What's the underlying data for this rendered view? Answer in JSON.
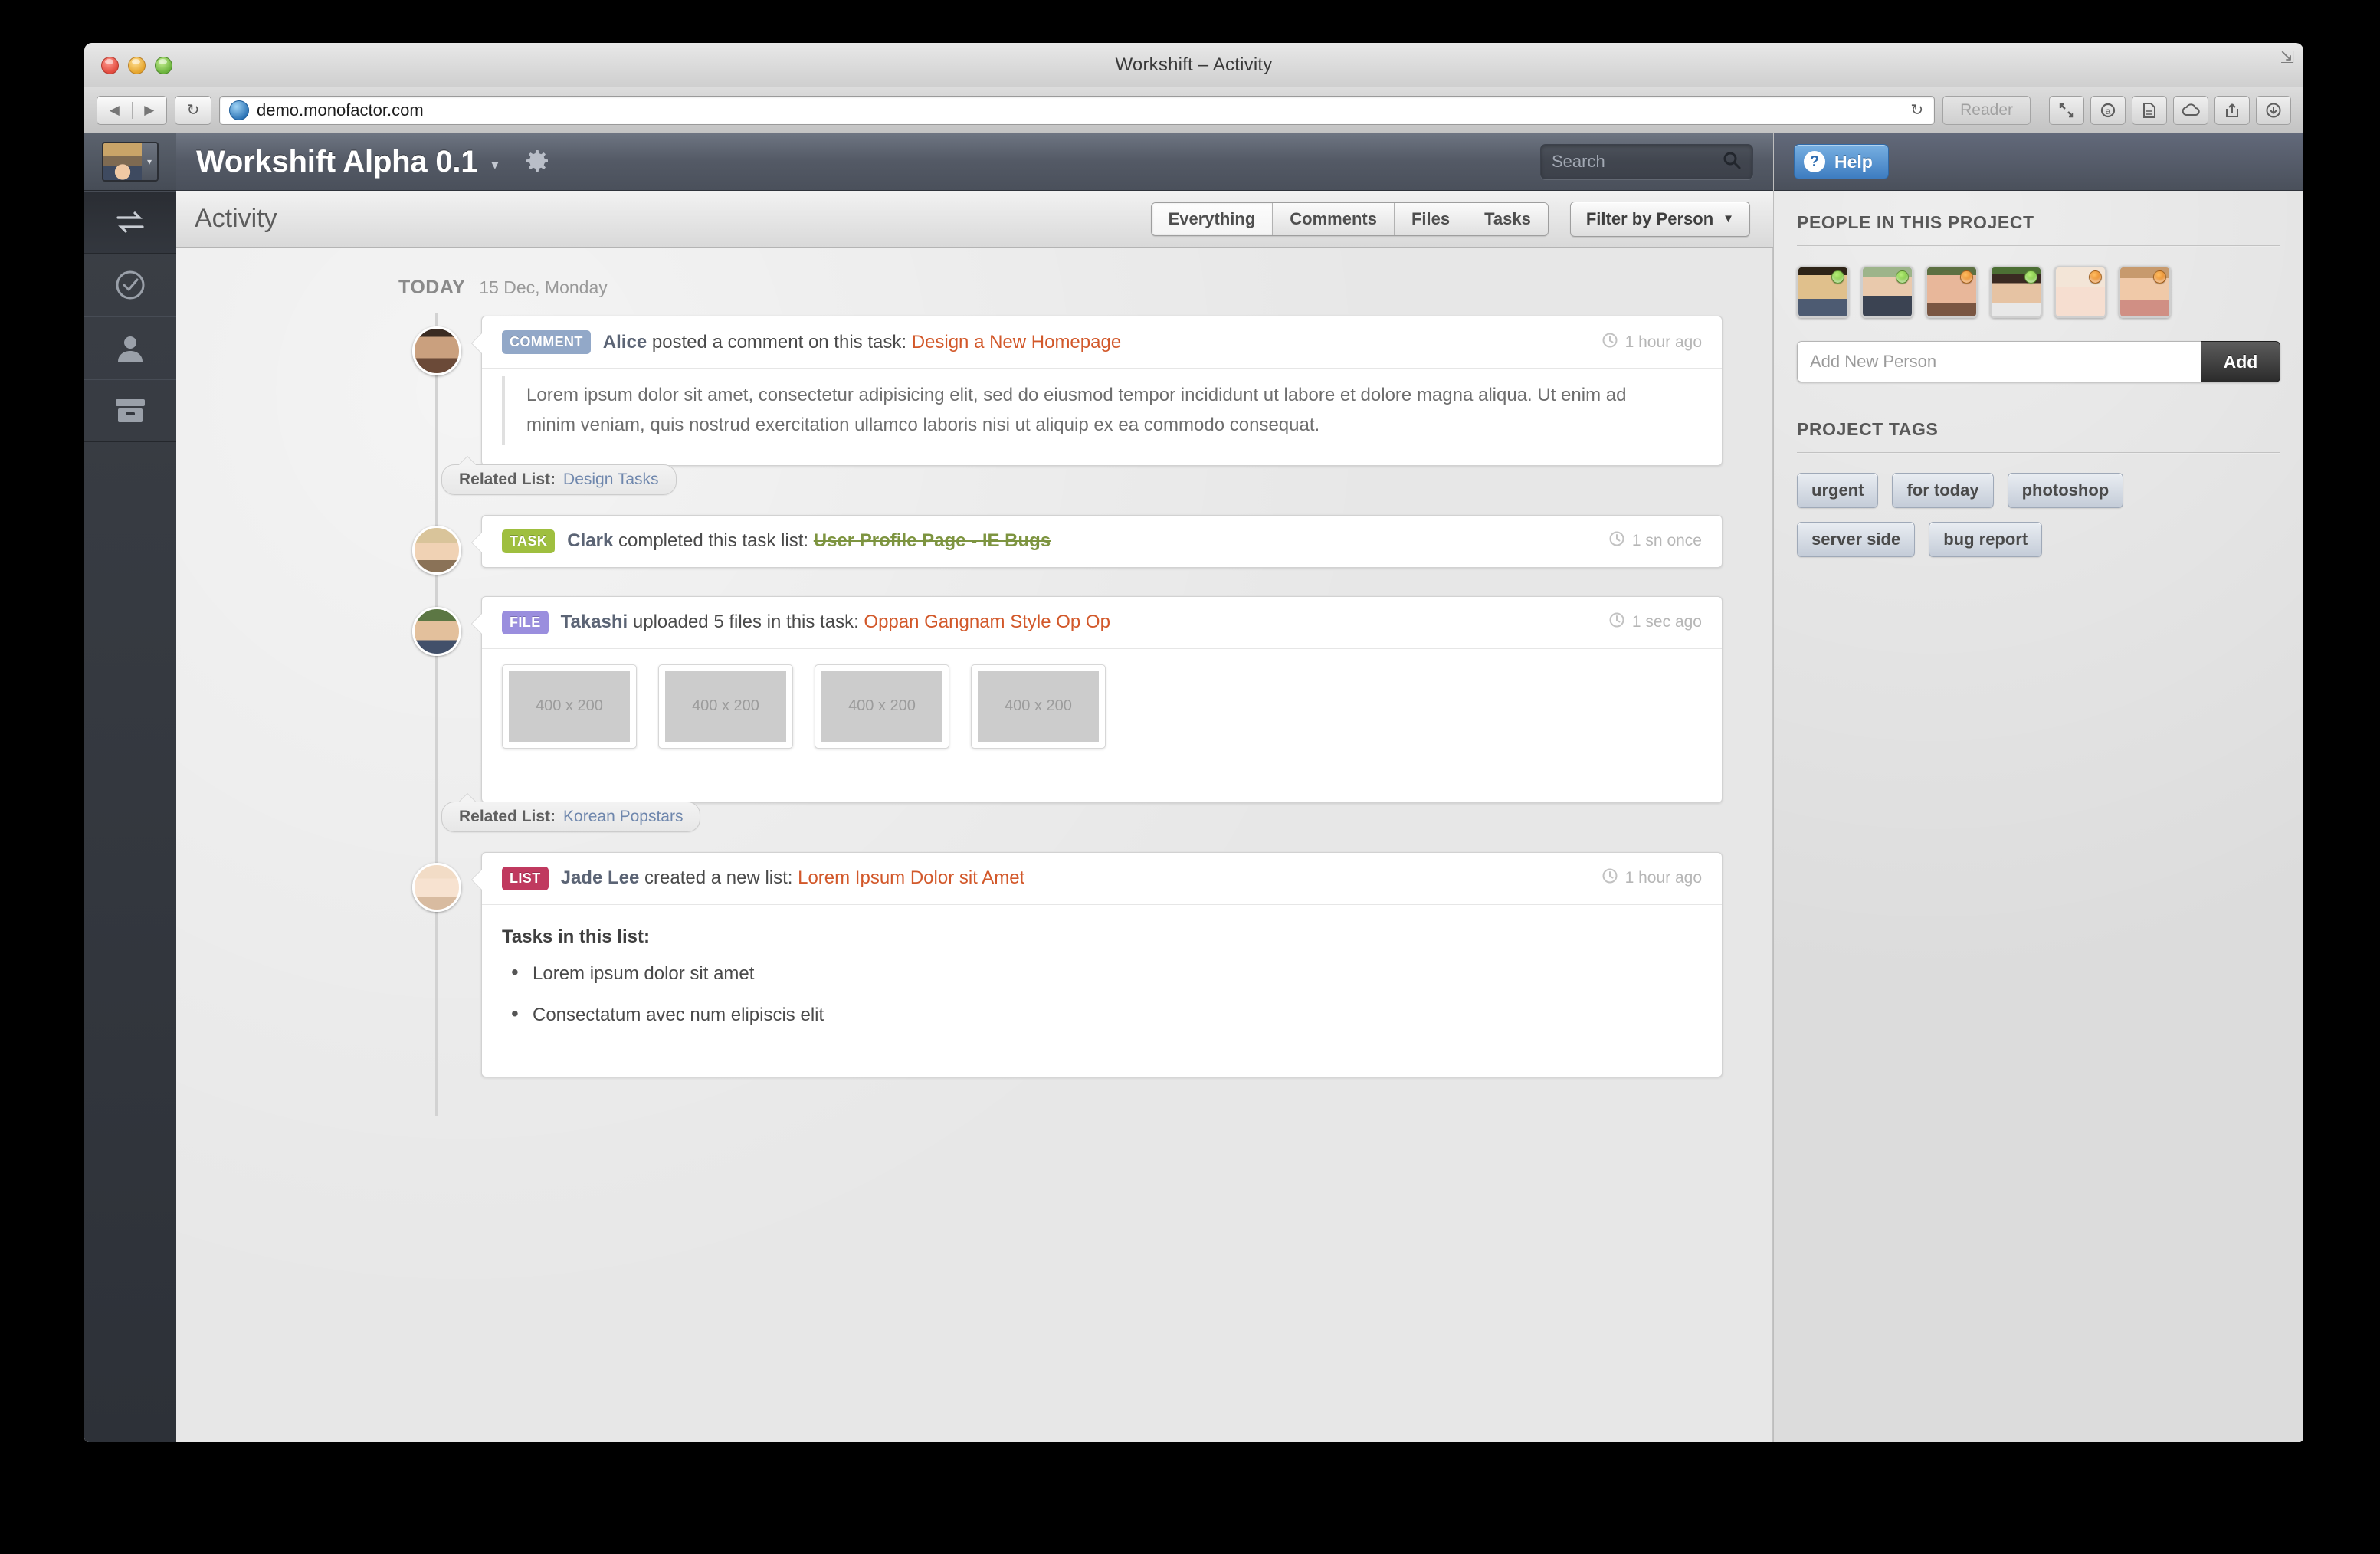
{
  "browser": {
    "window_title": "Workshift – Activity",
    "url": "demo.monofactor.com",
    "reader_label": "Reader",
    "back_icon": "back-arrow-icon",
    "forward_icon": "forward-arrow-icon",
    "reload_icon": "reload-icon",
    "globe_icon": "globe-icon",
    "toolbar_icons": [
      "fullscreen-icon",
      "private-browsing-icon",
      "reading-list-icon",
      "icloud-tabs-icon",
      "share-icon",
      "downloads-icon"
    ]
  },
  "rail": {
    "avatar": "user-avatar",
    "items": [
      {
        "name": "activity",
        "icon": "activity-arrows-icon"
      },
      {
        "name": "tasks",
        "icon": "check-circle-icon"
      },
      {
        "name": "people",
        "icon": "person-icon"
      },
      {
        "name": "archive",
        "icon": "archive-box-icon"
      }
    ]
  },
  "header": {
    "app_title": "Workshift Alpha 0.1",
    "title_caret": "▾",
    "gear_icon": "gear-icon",
    "search_placeholder": "Search",
    "search_icon": "search-icon",
    "help_label": "Help",
    "help_icon": "question-mark-icon"
  },
  "sub_header": {
    "page_title": "Activity",
    "tabs": [
      {
        "label": "Everything",
        "active": true
      },
      {
        "label": "Comments",
        "active": false
      },
      {
        "label": "Files",
        "active": false
      },
      {
        "label": "Tasks",
        "active": false
      }
    ],
    "filter_label": "Filter by Person",
    "filter_caret": "▼"
  },
  "feed": {
    "today_label": "TODAY",
    "today_date": "15 Dec, Monday",
    "entries": [
      {
        "badge": "COMMENT",
        "badge_type": "comment",
        "who": "Alice",
        "action": " posted a comment on this task: ",
        "target": "Design a New Homepage",
        "timestamp": "1 hour ago",
        "quote": "Lorem ipsum dolor sit amet, consectetur adipisicing elit, sed do eiusmod tempor incididunt ut labore et dolore magna aliqua. Ut enim ad minim veniam, quis nostrud exercitation ullamco laboris nisi ut aliquip ex ea commodo consequat.",
        "related_label": "Related List:",
        "related_link": "Design Tasks"
      },
      {
        "badge": "TASK",
        "badge_type": "task",
        "who": "Clark",
        "action": " completed this task list: ",
        "target": "User Profile Page - IE Bugs",
        "timestamp": "1 sn once"
      },
      {
        "badge": "FILE",
        "badge_type": "file",
        "who": "Takashi",
        "action": " uploaded 5 files in this task: ",
        "target": "Oppan Gangnam Style Op Op",
        "timestamp": "1 sec ago",
        "thumbs": [
          "400 x 200",
          "400 x 200",
          "400 x 200",
          "400 x 200"
        ],
        "related_label": "Related List:",
        "related_link": "Korean Popstars"
      },
      {
        "badge": "LIST",
        "badge_type": "list",
        "who": "Jade Lee",
        "action": " created a new list: ",
        "target": "Lorem Ipsum Dolor sit Amet",
        "timestamp": "1 hour ago",
        "tasks_title": "Tasks in this list:",
        "tasks": [
          "Lorem ipsum dolor sit amet",
          "Consectatum avec num elipiscis elit"
        ]
      }
    ]
  },
  "right_panel": {
    "people_heading": "PEOPLE IN THIS PROJECT",
    "people": [
      {
        "name": "person-1",
        "status": "online"
      },
      {
        "name": "person-2",
        "status": "online"
      },
      {
        "name": "person-3",
        "status": "away"
      },
      {
        "name": "person-4",
        "status": "online"
      },
      {
        "name": "person-5",
        "status": "away"
      },
      {
        "name": "person-6",
        "status": "away"
      }
    ],
    "add_person_placeholder": "Add New Person",
    "add_button_label": "Add",
    "tags_heading": "PROJECT TAGS",
    "tags": [
      "urgent",
      "for today",
      "photoshop",
      "server side",
      "bug report"
    ]
  },
  "colors": {
    "accent_link": "#d2582a",
    "related_link": "#6f87ad",
    "badge_comment": "#92a8c8",
    "badge_task": "#9fbf3f",
    "badge_file": "#9a8ede",
    "badge_list": "#c0395f",
    "help_blue": "#3d7cc0",
    "status_online": "#6ec72e",
    "status_away": "#e87818"
  }
}
